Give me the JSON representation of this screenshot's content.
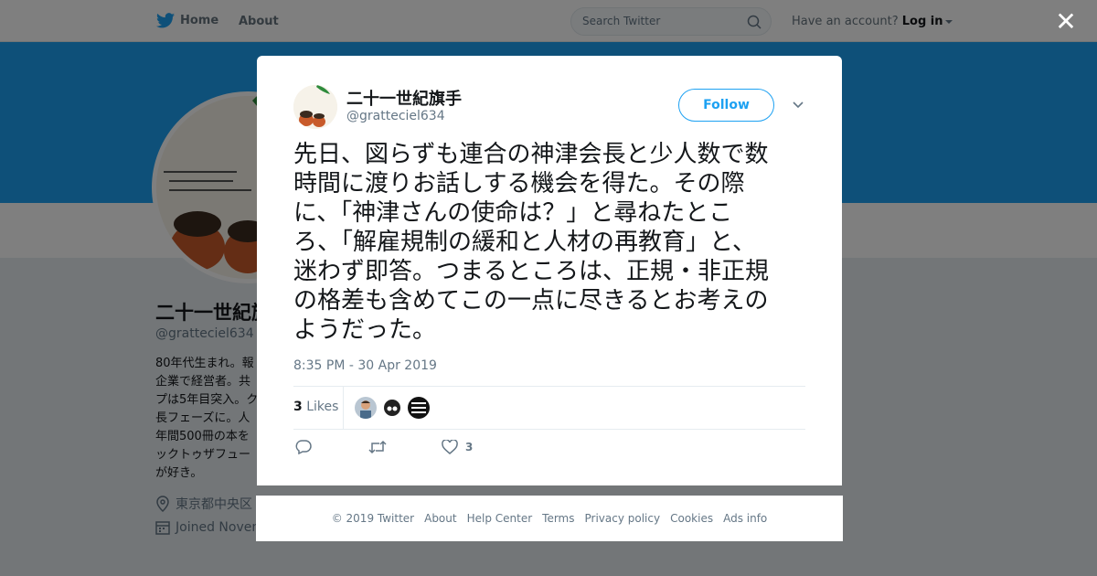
{
  "topbar": {
    "home_label": "Home",
    "about_label": "About",
    "search_placeholder": "Search Twitter",
    "account_prompt": "Have an account?",
    "login_label": "Log in"
  },
  "background_profile": {
    "name": "二十一世紀旗手",
    "handle": "@gratteciel634",
    "bio_lines": [
      "80年代生まれ。報",
      "企業で経営者。共",
      "プは5年目突入。ク",
      "長フェーズに。人",
      "年間500冊の本を",
      "ックトゥザフュー",
      "が好き。"
    ],
    "location": "東京都中央区",
    "joined": "Joined Novem"
  },
  "modal": {
    "name": "二十一世紀旗手",
    "handle": "@gratteciel634",
    "follow_label": "Follow",
    "tweet_lines": [
      "先日、図らずも連合の神津会長と少人数で数",
      "時間に渡りお話しする機会を得た。その際",
      "に、「神津さんの使命は？」と尋ねたとこ",
      "ろ、「解雇規制の緩和と人材の再教育」と、",
      "迷わず即答。つまるところは、正規・非正規",
      "の格差も含めてこの一点に尽きるとお考えの",
      "ようだった。"
    ],
    "timestamp": "8:35 PM - 30 Apr 2019",
    "likes_count": "3",
    "likes_label": "Likes",
    "like_action_count": "3"
  },
  "footer": {
    "links": [
      "© 2019 Twitter",
      "About",
      "Help Center",
      "Terms",
      "Privacy policy",
      "Cookies",
      "Ads info"
    ]
  },
  "colors": {
    "brand": "#1da1f2",
    "text": "#14171a",
    "muted": "#657786"
  }
}
